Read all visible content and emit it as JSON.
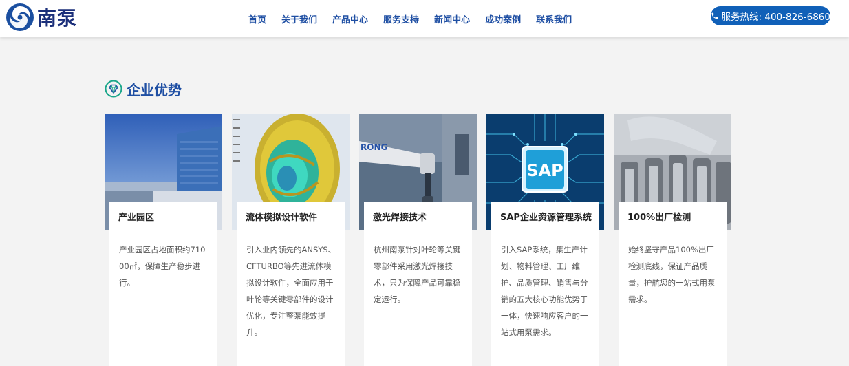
{
  "header": {
    "logo_text": "南泵",
    "nav": [
      "首页",
      "关于我们",
      "产品中心",
      "服务支持",
      "新闻中心",
      "成功案例",
      "联系我们"
    ],
    "hotline": "服务热线: 400-826-6860"
  },
  "section": {
    "title": "企业优势"
  },
  "cards": [
    {
      "title": "产业园区",
      "desc": "产业园区占地面积约71000㎡，保障生产稳步进行。"
    },
    {
      "title": "流体模拟设计软件",
      "desc": "引入业内领先的ANSYS、CFTURBO等先进流体模拟设计软件，全面应用于叶轮等关键零部件的设计优化，专注整泵能效提升。"
    },
    {
      "title": "激光焊接技术",
      "desc": "杭州南泵针对叶轮等关键零部件采用激光焊接技术，只为保障产品可靠稳定运行。"
    },
    {
      "title": "SAP企业资源管理系统",
      "desc": "引入SAP系统，集生产计划、物料管理、工厂维护、品质管理、销售与分销的五大核心功能优势于一体，快速响应客户的一站式用泵需求。"
    },
    {
      "title": "100%出厂检测",
      "desc": "始终坚守产品100%出厂检测底线，保证产品质量，护航您的一站式用泵需求。"
    }
  ],
  "images": {
    "sap_label": "SAP",
    "robot_label": "RONG"
  },
  "colors": {
    "brand_blue": "#1f4fa3",
    "hotline_bg": "#1060b8",
    "logo_navy": "#1b2f7a"
  }
}
